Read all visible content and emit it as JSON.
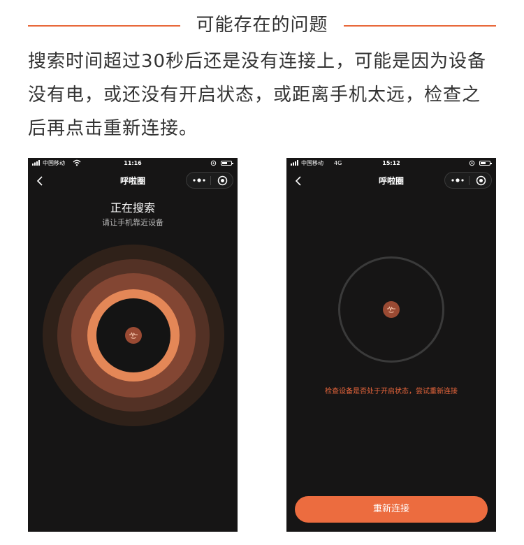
{
  "section": {
    "title": "可能存在的问题",
    "description": "搜索时间超过30秒后还是没有连接上，可能是因为设备没有电，或还没有开启状态，或距离手机太远，检查之后再点击重新连接。",
    "accent_color": "#e8683a"
  },
  "phone1": {
    "status": {
      "carrier": "中国移动",
      "network_icon": "wifi-icon",
      "time": "11:16"
    },
    "nav": {
      "title": "呼啦圈",
      "back_icon": "chevron-left-icon",
      "more_icon": "more-dots-icon",
      "close_icon": "target-circle-icon"
    },
    "heading": "正在搜索",
    "subheading": "请让手机靠近设备",
    "ring_colors": [
      "#2f2119",
      "#533125",
      "#834633",
      "#e48757"
    ]
  },
  "phone2": {
    "status": {
      "carrier": "中国移动",
      "network": "4G",
      "time": "15:12"
    },
    "nav": {
      "title": "呼啦圈"
    },
    "hint": "检查设备是否处于开启状态，尝试重新连接",
    "button_label": "重新连接",
    "button_color": "#ec6c3f"
  }
}
